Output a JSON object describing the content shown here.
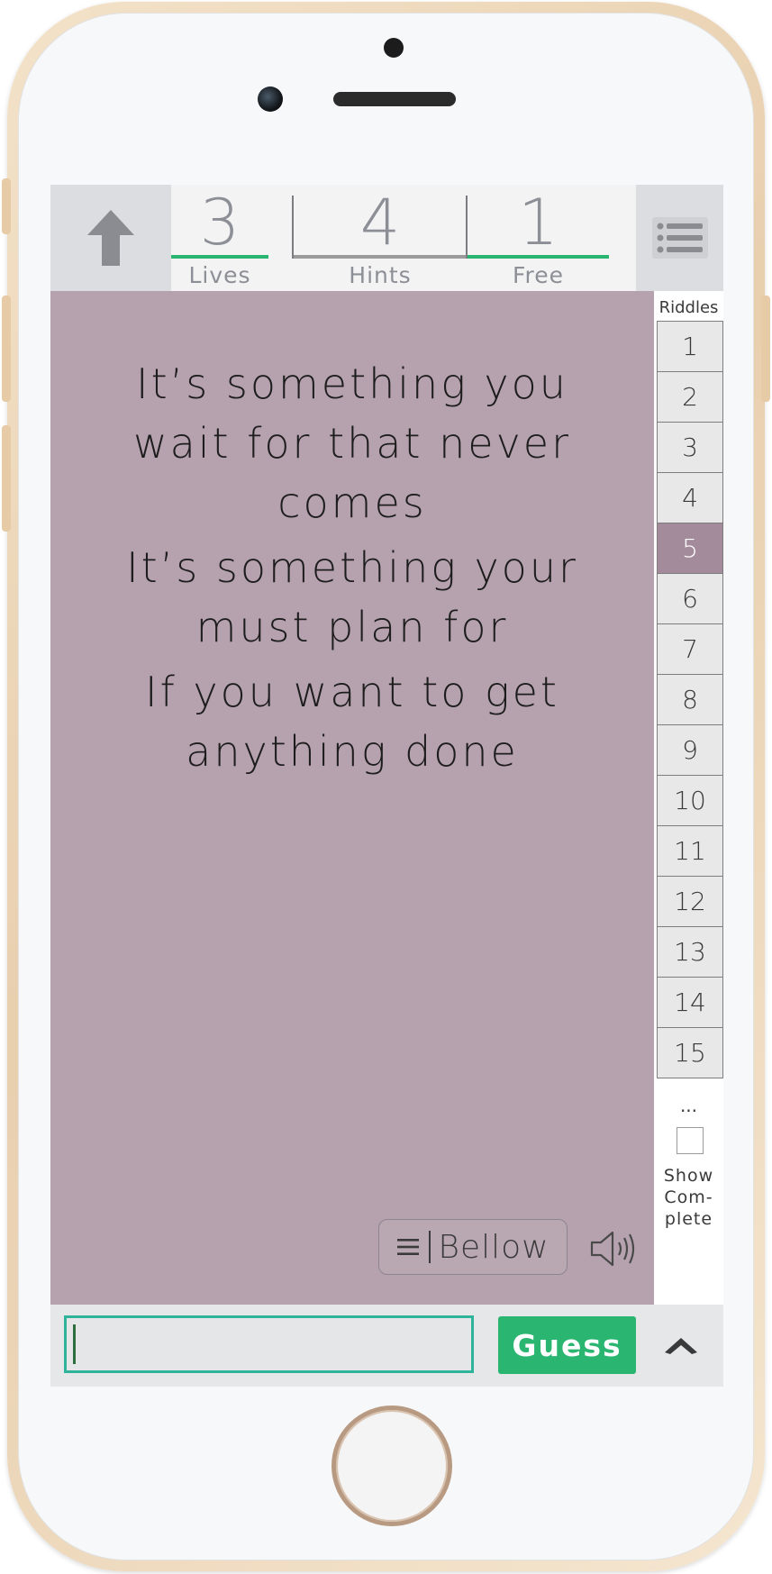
{
  "stats": {
    "lives": {
      "value": "3",
      "label": "Lives",
      "underline_color": "#2ab571"
    },
    "hints": {
      "value": "4",
      "label": "Hints",
      "underline_color": "#9b9b9b"
    },
    "free": {
      "value": "1",
      "label": "Free",
      "underline_color": "#2ab571"
    }
  },
  "nav": {
    "up_icon": "arrow-up-icon",
    "menu_icon": "menu-icon"
  },
  "riddle": {
    "lines": [
      "It’s something you wait for that never comes",
      "It’s something your must plan for",
      "If you want to get anything done"
    ],
    "background_color": "#b6a2ae"
  },
  "bellow": {
    "label": "Bellow",
    "icon": "menu-icon"
  },
  "speaker": {
    "icon": "speaker-icon"
  },
  "sidebar": {
    "title": "Riddles",
    "items": [
      "1",
      "2",
      "3",
      "4",
      "5",
      "6",
      "7",
      "8",
      "9",
      "10",
      "11",
      "12",
      "13",
      "14",
      "15"
    ],
    "active_index": 4,
    "ellipsis": "...",
    "show_complete_label_1": "Show",
    "show_complete_label_2": "Com-",
    "show_complete_label_3": "plete"
  },
  "bottom": {
    "input_value": "",
    "guess_label": "Guess",
    "guess_color": "#2ab571",
    "chevron_icon": "chevron-up-icon"
  }
}
